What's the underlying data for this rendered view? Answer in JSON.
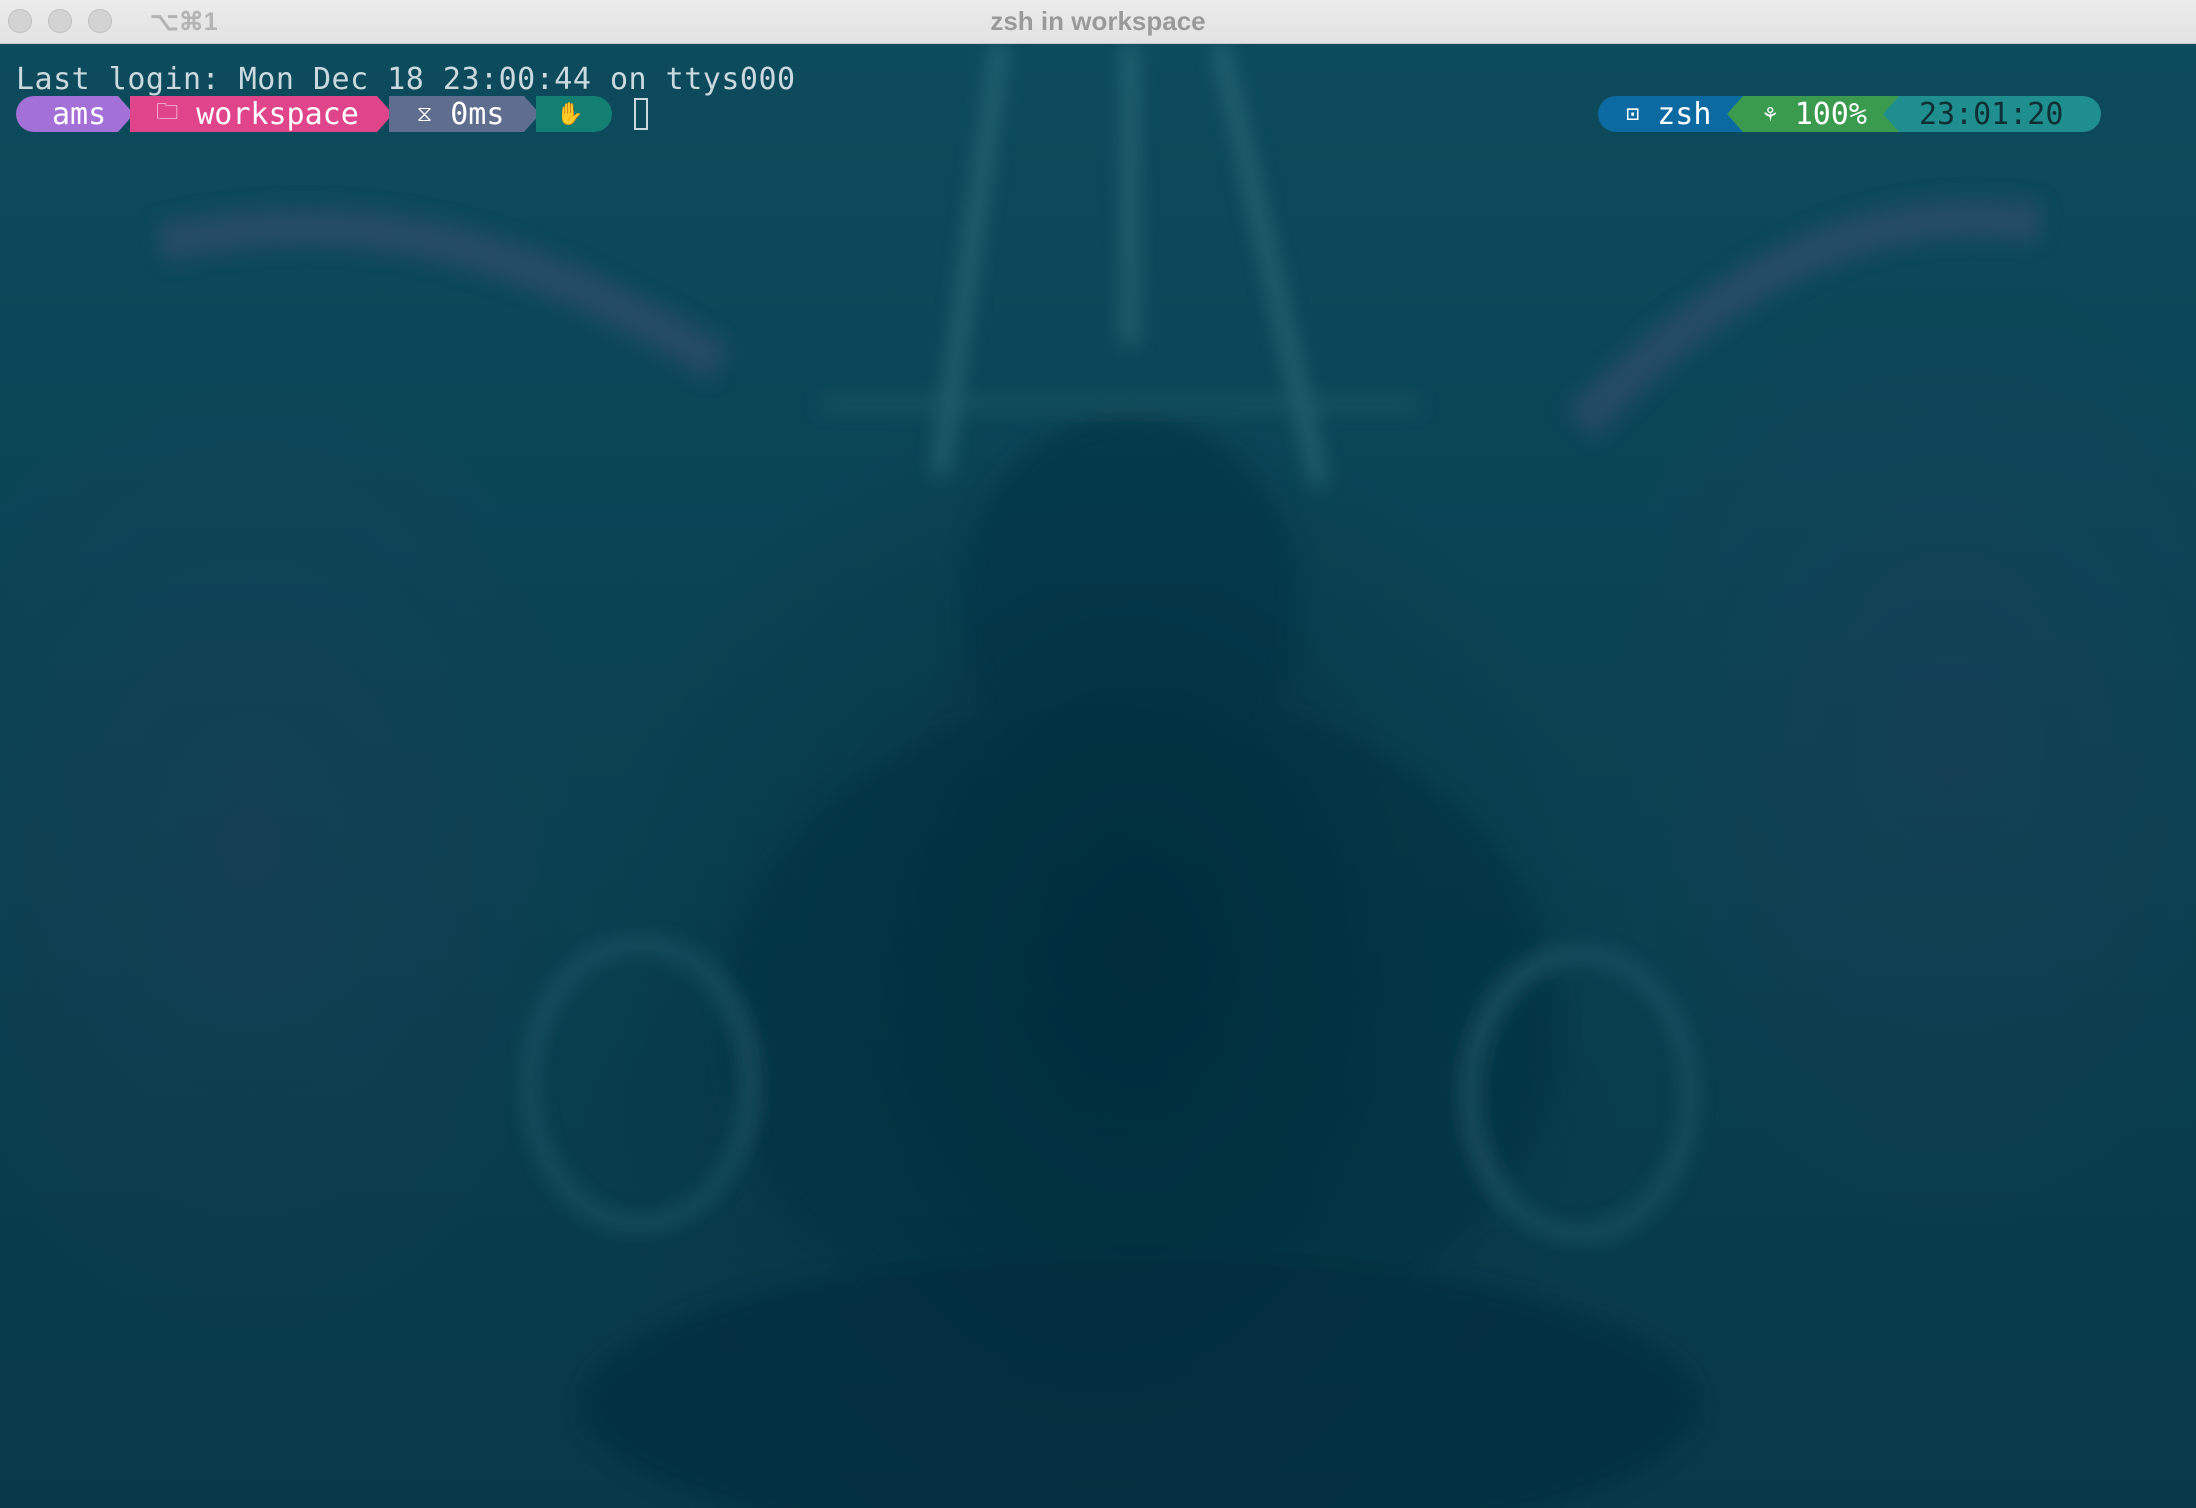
{
  "window": {
    "title": "zsh in workspace",
    "shortcut": "⌥⌘1"
  },
  "terminal": {
    "login_line": "Last login: Mon Dec 18 23:00:44 on ttys000"
  },
  "prompt_left": {
    "user": {
      "text": "ams",
      "color": "#a370d8"
    },
    "dir": {
      "icon": "folder-icon",
      "text": "workspace",
      "color": "#e0448a"
    },
    "duration": {
      "icon": "timer-icon",
      "text": "0ms",
      "color": "#5f6d8e"
    },
    "status": {
      "icon": "hand-icon",
      "color": "#137e72"
    }
  },
  "prompt_right": {
    "shell": {
      "icon": "terminal-icon",
      "text": "zsh",
      "color": "#0a6aa1"
    },
    "battery": {
      "icon": "sprout-icon",
      "text": "100%",
      "color": "#3a9b4f"
    },
    "time": {
      "text": "23:01:20",
      "color": "#1f8e8e"
    }
  }
}
